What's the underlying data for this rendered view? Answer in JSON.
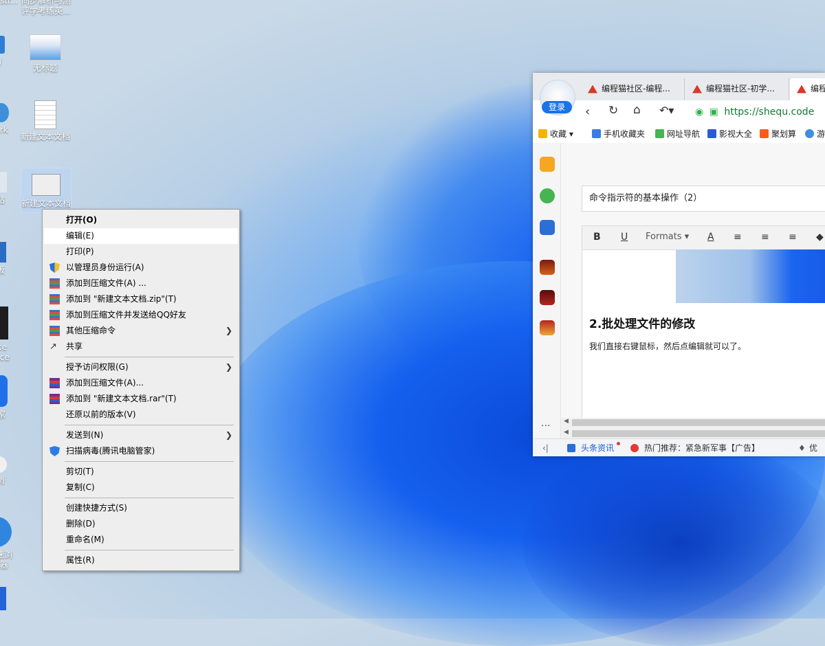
{
  "desktop": {
    "top_left_partial": "str...",
    "top_icon_lines": [
      "同步解析与测",
      "评学考练英..."
    ],
    "icons": [
      {
        "label": "无标题"
      },
      {
        "label": "新建文本文档"
      },
      {
        "label": "新建文本文档"
      }
    ],
    "left_partial_labels": [
      "脑",
      "ork",
      "站",
      "板",
      "ce",
      "nce",
      "家",
      "消",
      "速浏",
      "器"
    ]
  },
  "context_menu": {
    "items": [
      {
        "label": "打开(O)",
        "bold": true
      },
      {
        "label": "编辑(E)",
        "highlighted": true
      },
      {
        "label": "打印(P)"
      },
      {
        "label": "以管理员身份运行(A)",
        "icon": "shield-icon"
      },
      {
        "label": "添加到压缩文件(A) ...",
        "icon": "archive-icon"
      },
      {
        "label": "添加到 \"新建文本文档.zip\"(T)",
        "icon": "archive-icon"
      },
      {
        "label": "添加到压缩文件并发送给QQ好友",
        "icon": "archive-icon"
      },
      {
        "label": "其他压缩命令",
        "icon": "archive-icon",
        "submenu": true
      },
      {
        "label": "共享",
        "icon": "share-icon"
      },
      {
        "label": "授予访问权限(G)",
        "submenu": true
      },
      {
        "label": "添加到压缩文件(A)...",
        "icon": "winrar-icon"
      },
      {
        "label": "添加到 \"新建文本文档.rar\"(T)",
        "icon": "winrar-icon"
      },
      {
        "label": "还原以前的版本(V)"
      },
      {
        "label": "发送到(N)",
        "submenu": true
      },
      {
        "label": "扫描病毒(腾讯电脑管家)",
        "icon": "tencent-shield-icon"
      },
      {
        "label": "剪切(T)"
      },
      {
        "label": "复制(C)"
      },
      {
        "label": "创建快捷方式(S)"
      },
      {
        "label": "删除(D)"
      },
      {
        "label": "重命名(M)"
      },
      {
        "label": "属性(R)"
      }
    ]
  },
  "browser": {
    "login_label": "登录",
    "tabs": [
      "编程猫社区-编程...",
      "编程猫社区-初学...",
      "编程..."
    ],
    "url": "https://shequ.code",
    "bookmarks": [
      "收藏",
      "手机收藏夹",
      "网址导航",
      "影视大全",
      "聚划算",
      "游"
    ],
    "doc_title": "命令指示符的基本操作（2）",
    "toolbar": {
      "bold": "B",
      "underline": "U",
      "formats": "Formats"
    },
    "heading": "2.批处理文件的修改",
    "paragraph": "我们直接右键鼠标，然后点编辑就可以了。",
    "status": {
      "news": "头条资讯",
      "hot": "热门推荐：紧急新军事【广告】",
      "opt": "优化"
    },
    "more": "···"
  },
  "colors": {
    "accent": "#1a73e8",
    "menu_bg": "#eeeeee",
    "highlight": "#ffffff"
  }
}
